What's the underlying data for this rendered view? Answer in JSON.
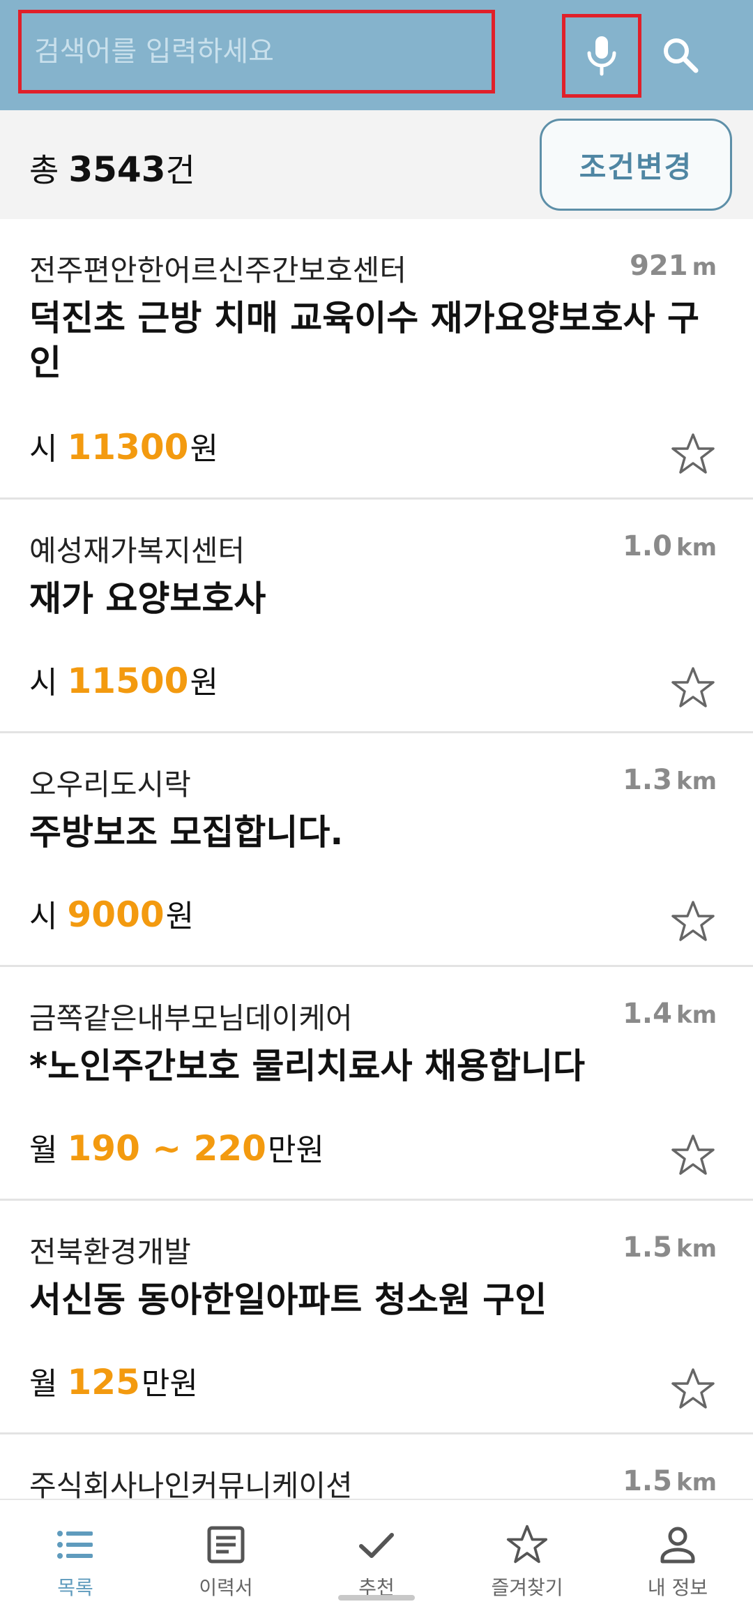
{
  "header": {
    "search_placeholder": "검색어를 입력하세요",
    "mic_icon": "mic-icon",
    "search_icon": "search-icon",
    "background_color": "#85b3cc"
  },
  "summary": {
    "prefix": "총",
    "count": "3543",
    "suffix": "건",
    "condition_button": "조건변경"
  },
  "jobs": [
    {
      "org": "전주편안한어르신주간보호센터",
      "distance": "921",
      "distance_unit": "m",
      "title": "덕진초 근방 치매 교육이수 재가요양보호사 구인",
      "pay_type": "시",
      "pay_value": "11300",
      "pay_unit": "원"
    },
    {
      "org": "예성재가복지센터",
      "distance": "1.0",
      "distance_unit": "km",
      "title": "재가 요양보호사",
      "pay_type": "시",
      "pay_value": "11500",
      "pay_unit": "원"
    },
    {
      "org": "오우리도시락",
      "distance": "1.3",
      "distance_unit": "km",
      "title": "주방보조 모집합니다.",
      "pay_type": "시",
      "pay_value": "9000",
      "pay_unit": "원"
    },
    {
      "org": "금쪽같은내부모님데이케어",
      "distance": "1.4",
      "distance_unit": "km",
      "title": "*노인주간보호 물리치료사 채용합니다",
      "pay_type": "월",
      "pay_value": "190 ~ 220",
      "pay_unit": "만원"
    },
    {
      "org": "전북환경개발",
      "distance": "1.5",
      "distance_unit": "km",
      "title": "서신동 동아한일아파트 청소원 구인",
      "pay_type": "월",
      "pay_value": "125",
      "pay_unit": "만원"
    },
    {
      "org": "주식회사나인커뮤니케이션",
      "distance": "1.5",
      "distance_unit": "km"
    }
  ],
  "nav": [
    {
      "label": "목록",
      "icon": "list-icon",
      "active": true
    },
    {
      "label": "이력서",
      "icon": "resume-icon",
      "active": false
    },
    {
      "label": "추천",
      "icon": "check-icon",
      "active": false
    },
    {
      "label": "즐겨찾기",
      "icon": "star-icon",
      "active": false
    },
    {
      "label": "내 정보",
      "icon": "person-icon",
      "active": false
    }
  ],
  "colors": {
    "accent": "#5f9bbd",
    "pay": "#f39a0f",
    "highlight_border": "#e0202a"
  }
}
